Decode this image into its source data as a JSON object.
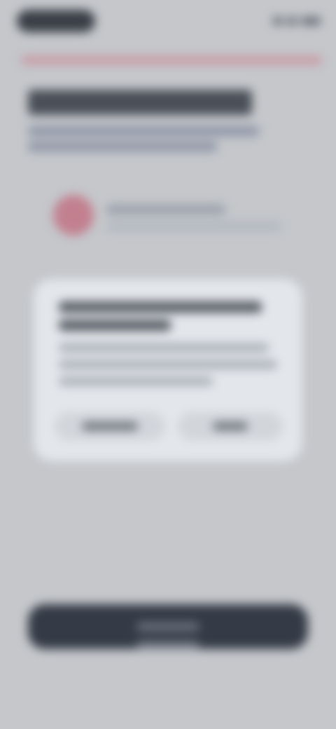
{
  "status_bar": {
    "time": "",
    "indicators": [
      "signal-icon",
      "wifi-icon",
      "battery-icon"
    ]
  },
  "header": {
    "title": "",
    "subtitle": ""
  },
  "alert": {
    "icon": "alert-icon",
    "text": "",
    "detail": ""
  },
  "dialog": {
    "title": "",
    "body": "",
    "secondary_label": "",
    "primary_label": ""
  },
  "footer": {
    "primary_label": ""
  },
  "colors": {
    "background": "#c5c7cb",
    "accent_red": "#c2808f",
    "card": "#e3e6ea",
    "primary_button": "#343b46"
  }
}
